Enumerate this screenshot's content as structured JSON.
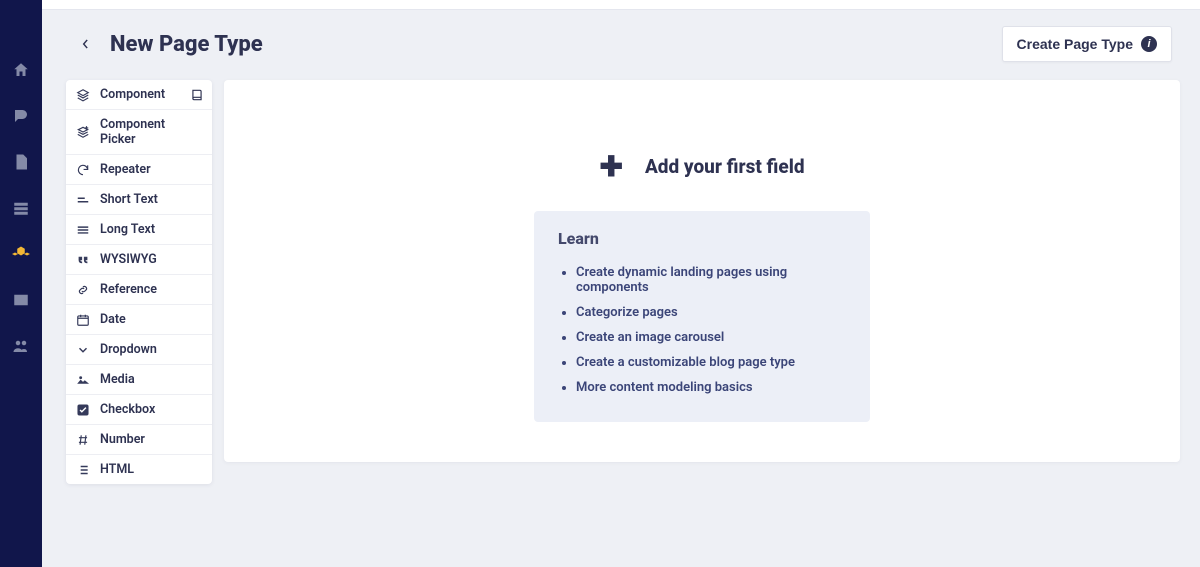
{
  "header": {
    "title": "New Page Type",
    "create_label": "Create Page Type"
  },
  "palette": {
    "items": [
      {
        "label": "Component",
        "icon": "layers",
        "has_help": true
      },
      {
        "label": "Component Picker",
        "icon": "layers-plus",
        "has_help": false
      },
      {
        "label": "Repeater",
        "icon": "rotate",
        "has_help": false
      },
      {
        "label": "Short Text",
        "icon": "short-lines",
        "has_help": false
      },
      {
        "label": "Long Text",
        "icon": "long-lines",
        "has_help": false
      },
      {
        "label": "WYSIWYG",
        "icon": "quotes",
        "has_help": false
      },
      {
        "label": "Reference",
        "icon": "link",
        "has_help": false
      },
      {
        "label": "Date",
        "icon": "calendar",
        "has_help": false
      },
      {
        "label": "Dropdown",
        "icon": "chevron-down",
        "has_help": false
      },
      {
        "label": "Media",
        "icon": "image",
        "has_help": false
      },
      {
        "label": "Checkbox",
        "icon": "checkbox",
        "has_help": false
      },
      {
        "label": "Number",
        "icon": "hash",
        "has_help": false
      },
      {
        "label": "HTML",
        "icon": "list",
        "has_help": false
      }
    ]
  },
  "workspace": {
    "add_first_label": "Add your first field",
    "learn_title": "Learn",
    "learn_links": [
      "Create dynamic landing pages using components",
      "Categorize pages",
      "Create an image carousel",
      "Create a customizable blog page type",
      "More content modeling basics"
    ]
  },
  "sidenav": {
    "items": [
      {
        "name": "home",
        "active": false
      },
      {
        "name": "blog",
        "active": false
      },
      {
        "name": "pages",
        "active": false
      },
      {
        "name": "collections",
        "active": false
      },
      {
        "name": "components",
        "active": true
      },
      {
        "name": "media",
        "active": false
      },
      {
        "name": "users",
        "active": false
      }
    ]
  }
}
